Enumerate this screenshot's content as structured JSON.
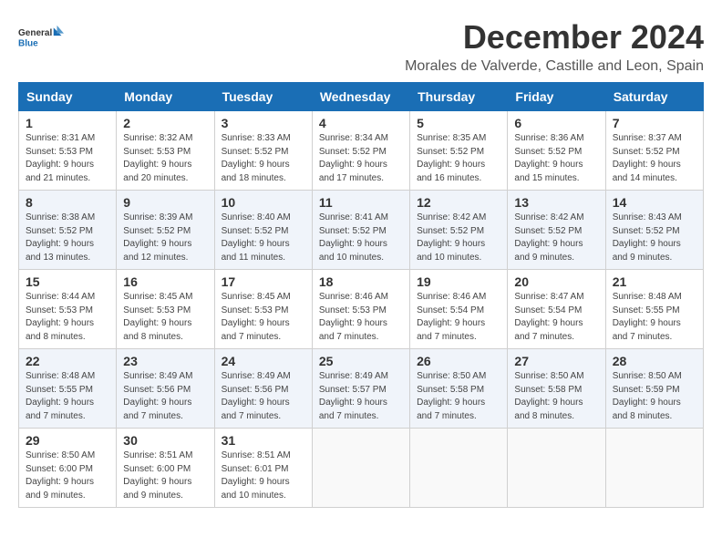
{
  "logo": {
    "line1": "General",
    "line2": "Blue"
  },
  "title": "December 2024",
  "subtitle": "Morales de Valverde, Castille and Leon, Spain",
  "headers": [
    "Sunday",
    "Monday",
    "Tuesday",
    "Wednesday",
    "Thursday",
    "Friday",
    "Saturday"
  ],
  "weeks": [
    [
      {
        "day": "1",
        "sunrise": "Sunrise: 8:31 AM",
        "sunset": "Sunset: 5:53 PM",
        "daylight": "Daylight: 9 hours and 21 minutes."
      },
      {
        "day": "2",
        "sunrise": "Sunrise: 8:32 AM",
        "sunset": "Sunset: 5:53 PM",
        "daylight": "Daylight: 9 hours and 20 minutes."
      },
      {
        "day": "3",
        "sunrise": "Sunrise: 8:33 AM",
        "sunset": "Sunset: 5:52 PM",
        "daylight": "Daylight: 9 hours and 18 minutes."
      },
      {
        "day": "4",
        "sunrise": "Sunrise: 8:34 AM",
        "sunset": "Sunset: 5:52 PM",
        "daylight": "Daylight: 9 hours and 17 minutes."
      },
      {
        "day": "5",
        "sunrise": "Sunrise: 8:35 AM",
        "sunset": "Sunset: 5:52 PM",
        "daylight": "Daylight: 9 hours and 16 minutes."
      },
      {
        "day": "6",
        "sunrise": "Sunrise: 8:36 AM",
        "sunset": "Sunset: 5:52 PM",
        "daylight": "Daylight: 9 hours and 15 minutes."
      },
      {
        "day": "7",
        "sunrise": "Sunrise: 8:37 AM",
        "sunset": "Sunset: 5:52 PM",
        "daylight": "Daylight: 9 hours and 14 minutes."
      }
    ],
    [
      {
        "day": "8",
        "sunrise": "Sunrise: 8:38 AM",
        "sunset": "Sunset: 5:52 PM",
        "daylight": "Daylight: 9 hours and 13 minutes."
      },
      {
        "day": "9",
        "sunrise": "Sunrise: 8:39 AM",
        "sunset": "Sunset: 5:52 PM",
        "daylight": "Daylight: 9 hours and 12 minutes."
      },
      {
        "day": "10",
        "sunrise": "Sunrise: 8:40 AM",
        "sunset": "Sunset: 5:52 PM",
        "daylight": "Daylight: 9 hours and 11 minutes."
      },
      {
        "day": "11",
        "sunrise": "Sunrise: 8:41 AM",
        "sunset": "Sunset: 5:52 PM",
        "daylight": "Daylight: 9 hours and 10 minutes."
      },
      {
        "day": "12",
        "sunrise": "Sunrise: 8:42 AM",
        "sunset": "Sunset: 5:52 PM",
        "daylight": "Daylight: 9 hours and 10 minutes."
      },
      {
        "day": "13",
        "sunrise": "Sunrise: 8:42 AM",
        "sunset": "Sunset: 5:52 PM",
        "daylight": "Daylight: 9 hours and 9 minutes."
      },
      {
        "day": "14",
        "sunrise": "Sunrise: 8:43 AM",
        "sunset": "Sunset: 5:52 PM",
        "daylight": "Daylight: 9 hours and 9 minutes."
      }
    ],
    [
      {
        "day": "15",
        "sunrise": "Sunrise: 8:44 AM",
        "sunset": "Sunset: 5:53 PM",
        "daylight": "Daylight: 9 hours and 8 minutes."
      },
      {
        "day": "16",
        "sunrise": "Sunrise: 8:45 AM",
        "sunset": "Sunset: 5:53 PM",
        "daylight": "Daylight: 9 hours and 8 minutes."
      },
      {
        "day": "17",
        "sunrise": "Sunrise: 8:45 AM",
        "sunset": "Sunset: 5:53 PM",
        "daylight": "Daylight: 9 hours and 7 minutes."
      },
      {
        "day": "18",
        "sunrise": "Sunrise: 8:46 AM",
        "sunset": "Sunset: 5:53 PM",
        "daylight": "Daylight: 9 hours and 7 minutes."
      },
      {
        "day": "19",
        "sunrise": "Sunrise: 8:46 AM",
        "sunset": "Sunset: 5:54 PM",
        "daylight": "Daylight: 9 hours and 7 minutes."
      },
      {
        "day": "20",
        "sunrise": "Sunrise: 8:47 AM",
        "sunset": "Sunset: 5:54 PM",
        "daylight": "Daylight: 9 hours and 7 minutes."
      },
      {
        "day": "21",
        "sunrise": "Sunrise: 8:48 AM",
        "sunset": "Sunset: 5:55 PM",
        "daylight": "Daylight: 9 hours and 7 minutes."
      }
    ],
    [
      {
        "day": "22",
        "sunrise": "Sunrise: 8:48 AM",
        "sunset": "Sunset: 5:55 PM",
        "daylight": "Daylight: 9 hours and 7 minutes."
      },
      {
        "day": "23",
        "sunrise": "Sunrise: 8:49 AM",
        "sunset": "Sunset: 5:56 PM",
        "daylight": "Daylight: 9 hours and 7 minutes."
      },
      {
        "day": "24",
        "sunrise": "Sunrise: 8:49 AM",
        "sunset": "Sunset: 5:56 PM",
        "daylight": "Daylight: 9 hours and 7 minutes."
      },
      {
        "day": "25",
        "sunrise": "Sunrise: 8:49 AM",
        "sunset": "Sunset: 5:57 PM",
        "daylight": "Daylight: 9 hours and 7 minutes."
      },
      {
        "day": "26",
        "sunrise": "Sunrise: 8:50 AM",
        "sunset": "Sunset: 5:58 PM",
        "daylight": "Daylight: 9 hours and 7 minutes."
      },
      {
        "day": "27",
        "sunrise": "Sunrise: 8:50 AM",
        "sunset": "Sunset: 5:58 PM",
        "daylight": "Daylight: 9 hours and 8 minutes."
      },
      {
        "day": "28",
        "sunrise": "Sunrise: 8:50 AM",
        "sunset": "Sunset: 5:59 PM",
        "daylight": "Daylight: 9 hours and 8 minutes."
      }
    ],
    [
      {
        "day": "29",
        "sunrise": "Sunrise: 8:50 AM",
        "sunset": "Sunset: 6:00 PM",
        "daylight": "Daylight: 9 hours and 9 minutes."
      },
      {
        "day": "30",
        "sunrise": "Sunrise: 8:51 AM",
        "sunset": "Sunset: 6:00 PM",
        "daylight": "Daylight: 9 hours and 9 minutes."
      },
      {
        "day": "31",
        "sunrise": "Sunrise: 8:51 AM",
        "sunset": "Sunset: 6:01 PM",
        "daylight": "Daylight: 9 hours and 10 minutes."
      },
      null,
      null,
      null,
      null
    ]
  ]
}
